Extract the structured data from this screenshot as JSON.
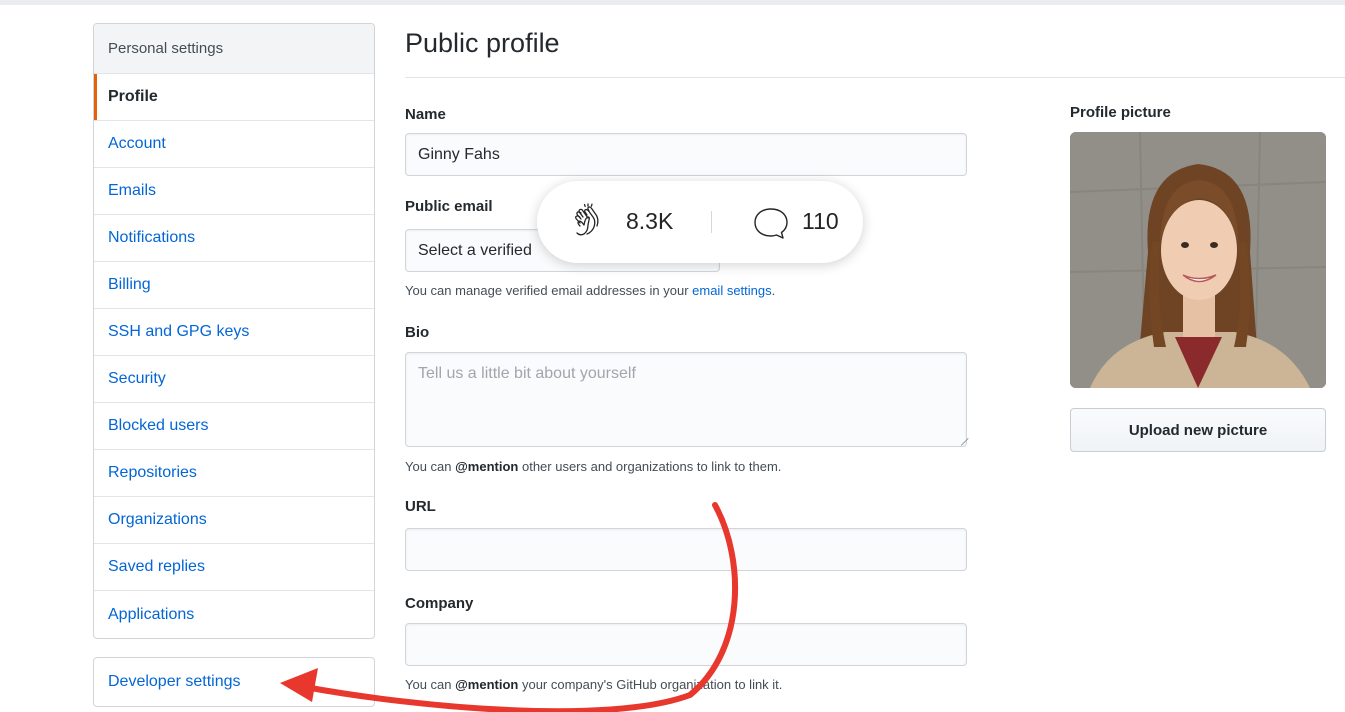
{
  "sidebar": {
    "heading": "Personal settings",
    "items": [
      {
        "label": "Profile"
      },
      {
        "label": "Account"
      },
      {
        "label": "Emails"
      },
      {
        "label": "Notifications"
      },
      {
        "label": "Billing"
      },
      {
        "label": "SSH and GPG keys"
      },
      {
        "label": "Security"
      },
      {
        "label": "Blocked users"
      },
      {
        "label": "Repositories"
      },
      {
        "label": "Organizations"
      },
      {
        "label": "Saved replies"
      },
      {
        "label": "Applications"
      }
    ],
    "developer_settings": "Developer settings"
  },
  "main": {
    "title": "Public profile",
    "name_label": "Name",
    "name_value": "Ginny Fahs",
    "email_label": "Public email",
    "email_value": "Select a verified",
    "email_note_prefix": "You can manage verified email addresses in your ",
    "email_note_link": "email settings",
    "email_note_suffix": ".",
    "bio_label": "Bio",
    "bio_placeholder": "Tell us a little bit about yourself",
    "bio_note_prefix": "You can ",
    "bio_note_mention": "@mention",
    "bio_note_suffix": " other users and organizations to link to them.",
    "url_label": "URL",
    "url_value": "",
    "company_label": "Company",
    "company_value": "",
    "company_note_prefix": "You can ",
    "company_note_mention": "@mention",
    "company_note_suffix": " your company's GitHub organization to link it."
  },
  "profile_picture": {
    "label": "Profile picture",
    "upload_button": "Upload new picture"
  },
  "stats": {
    "claps": "8.3K",
    "responses": "110"
  },
  "colors": {
    "link": "#0366d6",
    "selected_accent": "#e36209",
    "annotation_arrow": "#e8372c"
  }
}
